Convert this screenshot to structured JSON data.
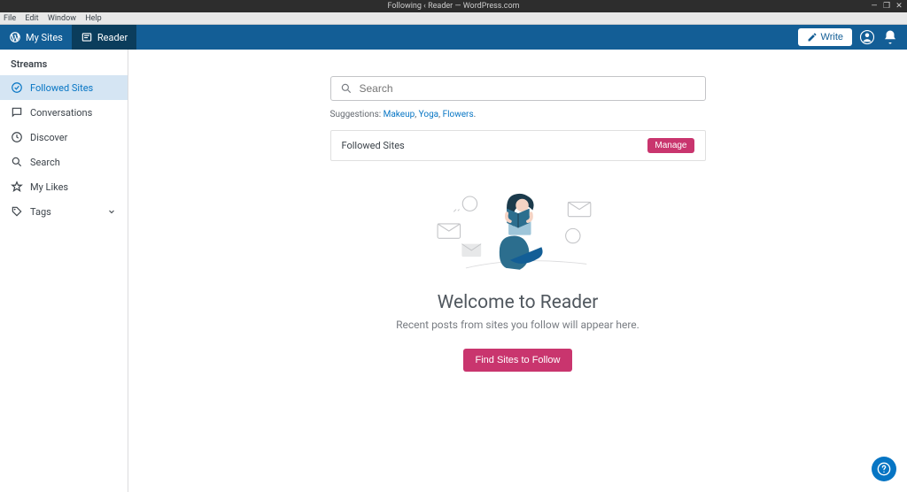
{
  "os": {
    "title": "Following ‹ Reader — WordPress.com",
    "menu": [
      "File",
      "Edit",
      "Window",
      "Help"
    ],
    "controls": {
      "min": "—",
      "max": "❐",
      "close": "✕"
    }
  },
  "topbar": {
    "my_sites": "My Sites",
    "reader": "Reader",
    "write": "Write"
  },
  "sidebar": {
    "heading": "Streams",
    "items": [
      {
        "label": "Followed Sites"
      },
      {
        "label": "Conversations"
      },
      {
        "label": "Discover"
      },
      {
        "label": "Search"
      },
      {
        "label": "My Likes"
      },
      {
        "label": "Tags"
      }
    ]
  },
  "search": {
    "placeholder": "Search"
  },
  "suggestions": {
    "label": "Suggestions:",
    "items": [
      "Makeup",
      "Yoga",
      "Flowers"
    ],
    "trailing": "."
  },
  "followed_card": {
    "title": "Followed Sites",
    "manage": "Manage"
  },
  "welcome": {
    "title": "Welcome to Reader",
    "subtitle": "Recent posts from sites you follow will appear here.",
    "cta": "Find Sites to Follow"
  }
}
